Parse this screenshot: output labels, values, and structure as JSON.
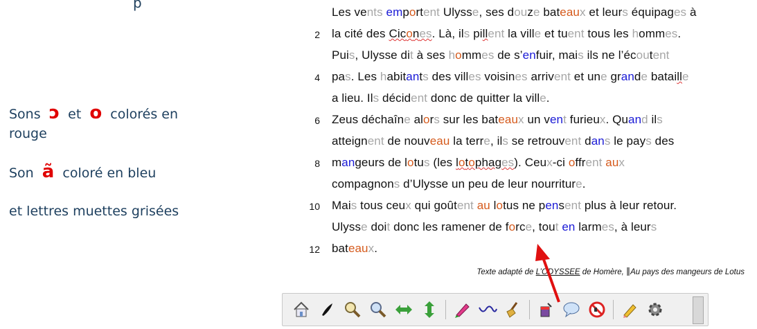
{
  "left_panel": {
    "top_partial": "p",
    "legend_line1_a": "Sons",
    "legend_line1_sym1": "ɔ",
    "legend_line1_mid": "et",
    "legend_line1_sym2": "o",
    "legend_line1_end": "colorés en",
    "legend_line2": "rouge",
    "legend_line3_a": "Son",
    "legend_line3_sym": "ã",
    "legend_line3_end": "coloré en bleu",
    "legend_line4": "et lettres muettes grisées"
  },
  "text": {
    "line_numbers": [
      "2",
      "4",
      "6",
      "8",
      "10",
      "12"
    ],
    "lines": [
      "Les vents emportent Ulysse, ses douze bateaux et leurs équipages à",
      "la cité des Cicones. Là, ils pillent la ville et tuent tous les hommes.",
      "Puis, Ulysse dit à ses hommes de s’enfuir, mais ils ne l’écoutent",
      "pas. Les habitants des villes voisines arrivent et une grande bataille",
      "a lieu. Ils décident donc de quitter la ville.",
      "Zeus déchaîne alors sur les bateaux un vent furieux. Quand ils",
      "atteignent de nouveau la terre, ils se retrouvent dans le pays des",
      "mangeurs de lotus (les lotophages). Ceux-ci offrent aux",
      "compagnons d’Ulysse un peu de leur nourriture.",
      "Mais tous ceux qui goûtent au lotus ne pensent plus à leur retour.",
      "Ulysse doit donc les ramener de force, tout en larmes, à leurs",
      "bateaux."
    ]
  },
  "credit": {
    "prefix": "Texte adapté de ",
    "book": "L’ODYSSEE",
    "middle": " de Homère, ",
    "suffix": "Au pays des mangeurs de Lotus"
  },
  "toolbar": {
    "buttons": [
      "home-icon",
      "pen-icon",
      "zoom-out-icon",
      "zoom-in-icon",
      "horizontal-arrows-icon",
      "vertical-arrows-icon",
      "highlighter-icon",
      "wave-icon",
      "broom-icon",
      "paint-bucket-icon",
      "speech-bubble-icon",
      "no-sound-icon",
      "pencil-icon",
      "gear-icon"
    ]
  },
  "colors": {
    "red": "#e00000",
    "orange": "#d55a1c",
    "blue": "#1a1ad6",
    "grey": "#a6a6a6",
    "legend_text": "#1d3f5e"
  }
}
